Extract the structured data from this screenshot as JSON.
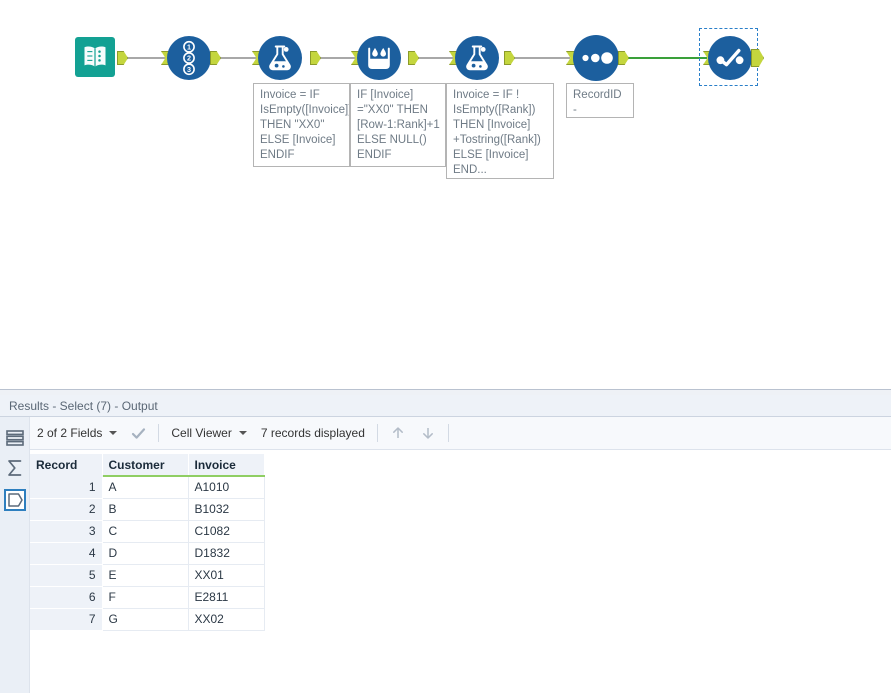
{
  "canvas": {
    "tools": [
      {
        "id": "text-input",
        "name": "Text Input",
        "icon": "book-icon"
      },
      {
        "id": "record-id",
        "name": "Record ID",
        "icon": "record-id-icon"
      },
      {
        "id": "formula-1",
        "name": "Formula",
        "icon": "flask-icon"
      },
      {
        "id": "multi-row-formula",
        "name": "Multi-Row Formula",
        "icon": "beaker-droplets-icon"
      },
      {
        "id": "formula-2",
        "name": "Formula",
        "icon": "flask-icon"
      },
      {
        "id": "sort",
        "name": "Sort",
        "icon": "sort-dots-icon"
      },
      {
        "id": "browse",
        "name": "Browse",
        "icon": "browse-check-icon"
      }
    ],
    "annotations": [
      {
        "id": "annotation-formula-1",
        "text": "Invoice = IF IsEmpty([Invoice]) THEN \"XX0\" ELSE [Invoice] ENDIF"
      },
      {
        "id": "annotation-multi-row-formula",
        "text": "IF [Invoice] =\"XX0\" THEN [Row-1:Rank]+1 ELSE NULL() ENDIF"
      },
      {
        "id": "annotation-formula-2",
        "text": "Invoice = IF ! IsEmpty([Rank]) THEN [Invoice] +Tostring([Rank]) ELSE [Invoice] END..."
      },
      {
        "id": "annotation-sort",
        "text": "RecordID - Ascending"
      }
    ],
    "colors": {
      "text_input": "#13a193",
      "tool_blue": "#1c5f9e",
      "wire": "#a8a8a8",
      "wire_active": "#3aa03a",
      "anchor": "#c4d63e",
      "selection": "#2a7fc9"
    }
  },
  "results": {
    "title": "Results - Select (7) - Output",
    "toolbar": {
      "fields_label": "2 of 2 Fields",
      "check_icon": "checkmark-icon",
      "viewer_label": "Cell Viewer",
      "records_label": "7 records displayed",
      "up_icon": "arrow-up-icon",
      "down_icon": "arrow-down-icon"
    },
    "rail": [
      {
        "id": "rail-grid",
        "icon": "grid-icon",
        "selected": false
      },
      {
        "id": "rail-summary",
        "icon": "sigma-icon",
        "selected": false
      },
      {
        "id": "rail-profile",
        "icon": "pentagon-icon",
        "selected": true
      }
    ],
    "grid": {
      "columns": [
        "Record",
        "Customer",
        "Invoice"
      ],
      "rows": [
        {
          "record": "1",
          "customer": "A",
          "invoice": "A1010"
        },
        {
          "record": "2",
          "customer": "B",
          "invoice": "B1032"
        },
        {
          "record": "3",
          "customer": "C",
          "invoice": "C1082"
        },
        {
          "record": "4",
          "customer": "D",
          "invoice": "D1832"
        },
        {
          "record": "5",
          "customer": "E",
          "invoice": "XX01"
        },
        {
          "record": "6",
          "customer": "F",
          "invoice": "E2811"
        },
        {
          "record": "7",
          "customer": "G",
          "invoice": "XX02"
        }
      ]
    }
  }
}
